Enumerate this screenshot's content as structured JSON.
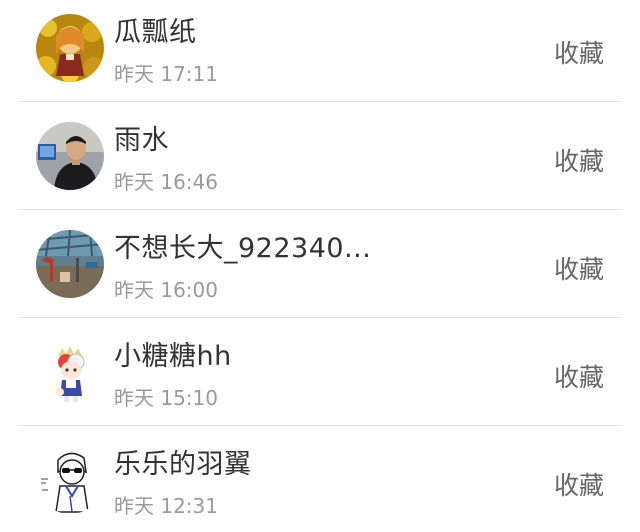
{
  "contacts": [
    {
      "name": "瓜瓢纸",
      "time": "昨天 17:11",
      "action": "收藏",
      "avatar": "avatar-anime-girl-yellow-flowers"
    },
    {
      "name": "雨水",
      "time": "昨天 16:46",
      "action": "收藏",
      "avatar": "avatar-man-photo"
    },
    {
      "name": "不想长大_922340...",
      "time": "昨天 16:00",
      "action": "收藏",
      "avatar": "avatar-aquarium-scene"
    },
    {
      "name": "小糖糖hh",
      "time": "昨天 15:10",
      "action": "收藏",
      "avatar": "avatar-chibi-character"
    },
    {
      "name": "乐乐的羽翼",
      "time": "昨天 12:31",
      "action": "收藏",
      "avatar": "avatar-sketch-boy-glasses"
    }
  ],
  "colors": {
    "name_text": "#333333",
    "time_text": "#9a9a9a",
    "action_text": "#666666",
    "divider": "#e2e2e2"
  }
}
